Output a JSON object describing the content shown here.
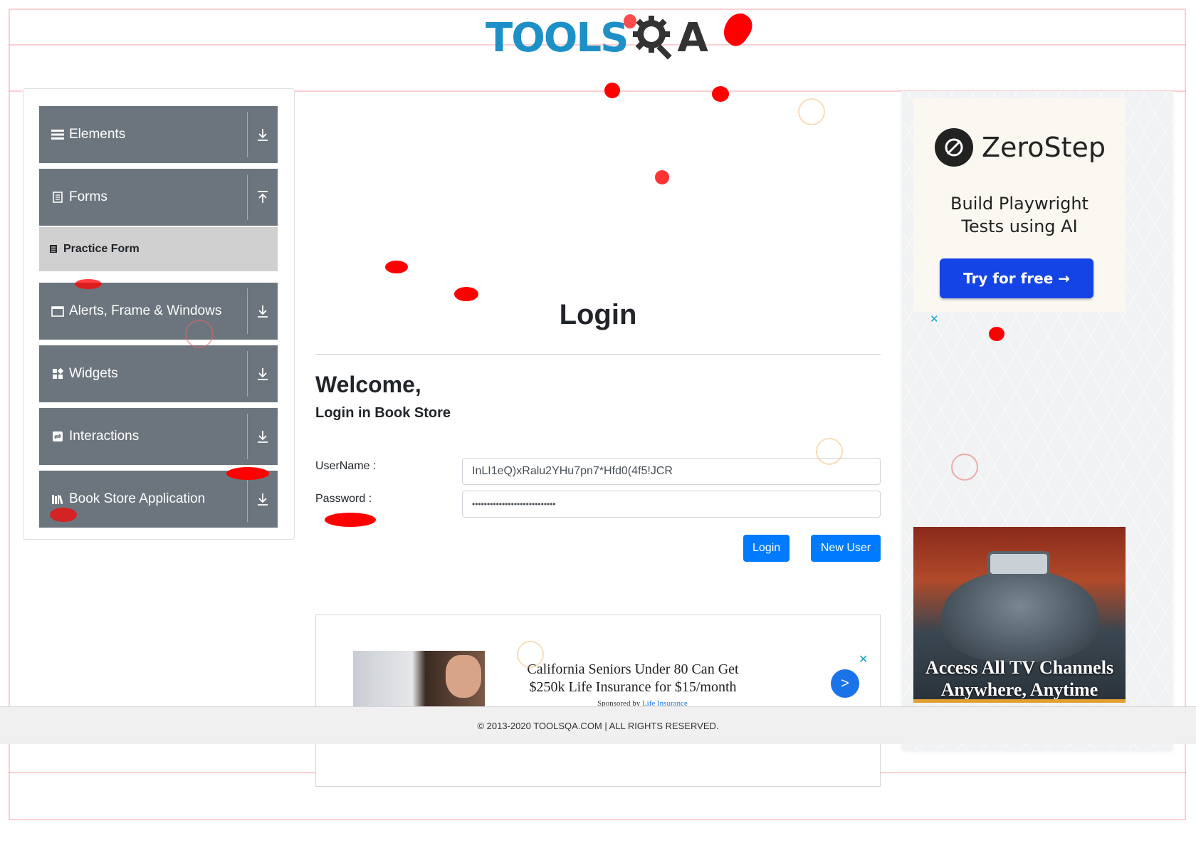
{
  "header": {
    "logo_text": "TOOLS",
    "logo_suffix": "A"
  },
  "sidebar": {
    "groups": [
      {
        "label": "Elements",
        "icon": "list-icon",
        "expanded": false
      },
      {
        "label": "Forms",
        "icon": "document-icon",
        "expanded": true
      },
      {
        "label": "Alerts, Frame & Windows",
        "icon": "window-icon",
        "expanded": false
      },
      {
        "label": "Widgets",
        "icon": "widgets-icon",
        "expanded": false
      },
      {
        "label": "Interactions",
        "icon": "interactions-icon",
        "expanded": false
      },
      {
        "label": "Book Store Application",
        "icon": "books-icon",
        "expanded": false
      }
    ],
    "sub_items": {
      "forms": [
        {
          "label": "Practice Form"
        }
      ]
    }
  },
  "main": {
    "title": "Login",
    "welcome": "Welcome,",
    "subtitle": "Login in Book Store",
    "username_label": "UserName :",
    "username_value": "InLI1eQ)xRalu2YHu7pn7*Hfd0(4f5!JCR",
    "password_label": "Password :",
    "password_value": "••••••••••••••••••••••••••••",
    "login_button": "Login",
    "new_user_button": "New User"
  },
  "ads": {
    "zerostep": {
      "name": "ZeroStep",
      "tagline_1": "Build Playwright",
      "tagline_2": "Tests using AI",
      "cta": "Try for free →"
    },
    "tv": {
      "line1": "Access All TV Channels",
      "line2": "Anywhere, Anytime"
    },
    "insurance": {
      "headline": "California Seniors Under 80 Can Get $250k Life Insurance for $15/month",
      "sponsored_prefix": "Sponsored by ",
      "sponsored_link": "Life Insurance",
      "go": ">"
    },
    "close_glyph": "✕"
  },
  "footer": {
    "text": "© 2013-2020 TOOLSQA.COM | ALL RIGHTS RESERVED."
  },
  "colors": {
    "nav_bg": "#6c757d",
    "active_sub_bg": "#d0d0d0",
    "primary": "#007bff",
    "logo_blue": "#1e90c8"
  }
}
